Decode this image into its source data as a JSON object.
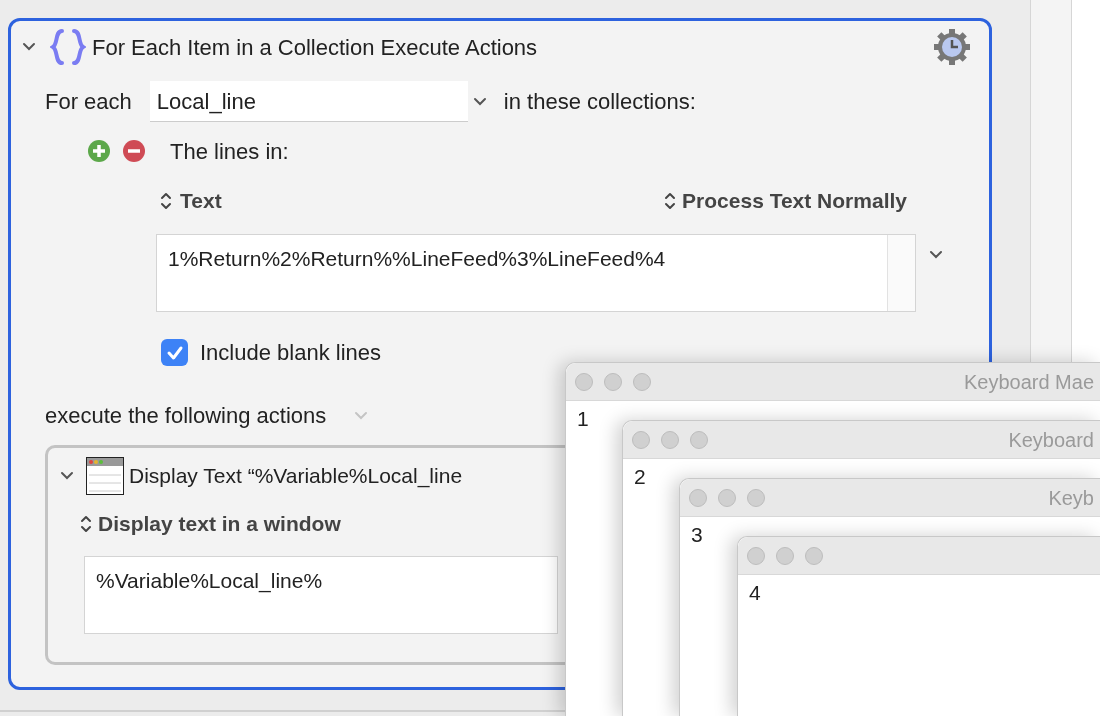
{
  "action": {
    "expanded": true,
    "title": "For Each Item in a Collection Execute Actions",
    "for_each_label": "For each",
    "variable": "Local_line",
    "collections_label": "in these collections:",
    "collection": {
      "label": "The lines in:",
      "source": "Text",
      "processing": "Process Text Normally",
      "text": "1%Return%2%Return%%LineFeed%3%LineFeed%4"
    },
    "include_blank_lines": {
      "label": "Include blank lines",
      "checked": true
    },
    "execute_label": "execute the following actions",
    "actions": [
      {
        "kind": "display_text",
        "expanded": true,
        "title": "Display Text “%Variable%Local_line",
        "mode": "Display text in a window",
        "text": "%Variable%Local_line%"
      }
    ]
  },
  "windows": [
    {
      "title": "Keyboard Mae",
      "text": "1"
    },
    {
      "title": "Keyboard",
      "text": "2"
    },
    {
      "title": "Keyb",
      "text": "3"
    },
    {
      "text": "4"
    }
  ]
}
